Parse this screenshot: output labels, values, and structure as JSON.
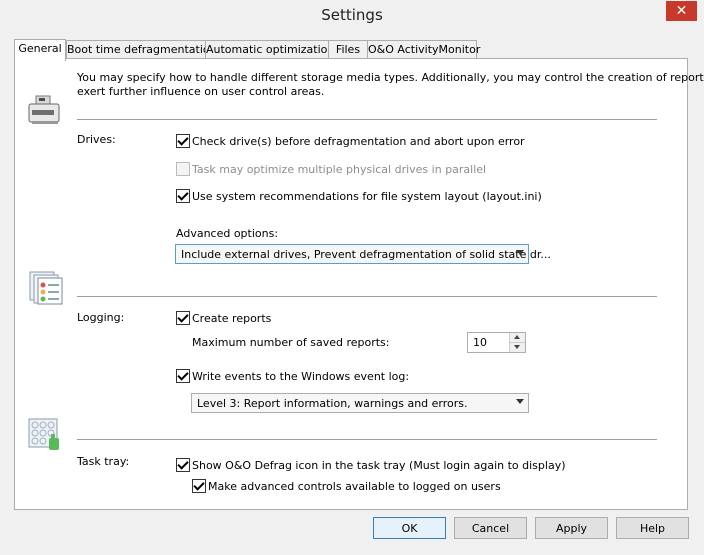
{
  "window": {
    "title": "Settings"
  },
  "tabs": [
    {
      "label": "General",
      "active": true
    },
    {
      "label": "Boot time defragmentation"
    },
    {
      "label": "Automatic optimization"
    },
    {
      "label": "Files"
    },
    {
      "label": "O&O ActivityMonitor"
    }
  ],
  "intro": {
    "line1": "You may specify how to handle different storage media types. Additionally, you may control the creation of reports and",
    "line2": "exert further influence on user control areas."
  },
  "drives": {
    "label": "Drives:",
    "check_before": {
      "label": "Check drive(s) before defragmentation and abort upon error",
      "checked": true
    },
    "parallel": {
      "label": "Task may optimize multiple physical drives in parallel",
      "checked": false,
      "disabled": true
    },
    "system_layout": {
      "label": "Use system recommendations for file system layout (layout.ini)",
      "checked": true
    },
    "advanced_label": "Advanced options:",
    "advanced_value": "Include external drives, Prevent defragmentation of solid state dr..."
  },
  "logging": {
    "label": "Logging:",
    "create_reports": {
      "label": "Create reports",
      "checked": true
    },
    "max_reports_label": "Maximum number of saved reports:",
    "max_reports_value": "10",
    "event_log": {
      "label": "Write events to the Windows event log:",
      "checked": true
    },
    "level_value": "Level 3: Report information, warnings and errors."
  },
  "tasktray": {
    "label": "Task tray:",
    "show_icon": {
      "label": "Show O&O Defrag icon in the task tray (Must login again to display)",
      "checked": true
    },
    "advanced_controls": {
      "label": "Make advanced controls available to logged on users",
      "checked": true
    }
  },
  "buttons": {
    "ok": "OK",
    "cancel": "Cancel",
    "apply": "Apply",
    "help": "Help"
  },
  "icons": {
    "close": "close-icon",
    "drive": "drive-icon",
    "reports": "reports-icon",
    "tray": "tray-icon"
  }
}
